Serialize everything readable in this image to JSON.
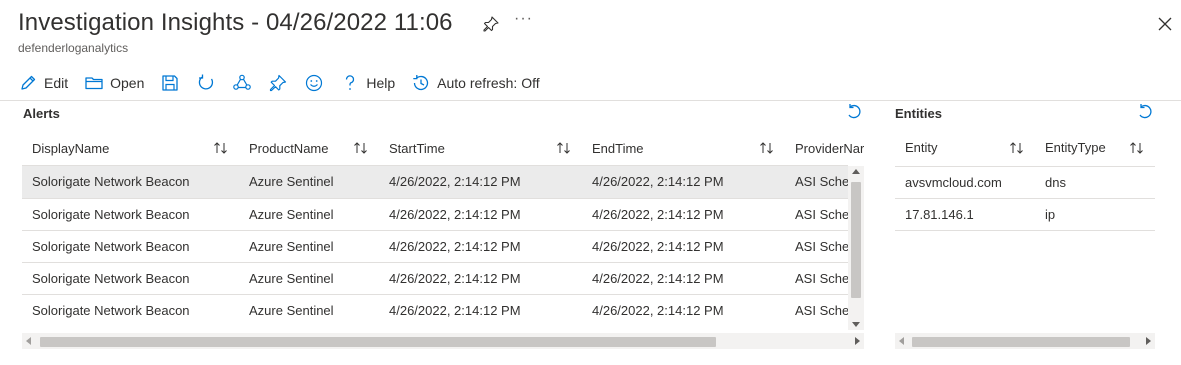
{
  "header": {
    "title": "Investigation Insights - 04/26/2022 11:06",
    "subtitle": "defenderloganalytics"
  },
  "toolbar": {
    "edit_label": "Edit",
    "open_label": "Open",
    "help_label": "Help",
    "auto_refresh_label": "Auto refresh: Off"
  },
  "alerts": {
    "title": "Alerts",
    "columns": [
      "DisplayName",
      "ProductName",
      "StartTime",
      "EndTime",
      "ProviderNar"
    ],
    "rows": [
      [
        "Solorigate Network Beacon",
        "Azure Sentinel",
        "4/26/2022, 2:14:12 PM",
        "4/26/2022, 2:14:12 PM",
        "ASI Sche"
      ],
      [
        "Solorigate Network Beacon",
        "Azure Sentinel",
        "4/26/2022, 2:14:12 PM",
        "4/26/2022, 2:14:12 PM",
        "ASI Sche"
      ],
      [
        "Solorigate Network Beacon",
        "Azure Sentinel",
        "4/26/2022, 2:14:12 PM",
        "4/26/2022, 2:14:12 PM",
        "ASI Sche"
      ],
      [
        "Solorigate Network Beacon",
        "Azure Sentinel",
        "4/26/2022, 2:14:12 PM",
        "4/26/2022, 2:14:12 PM",
        "ASI Sche"
      ],
      [
        "Solorigate Network Beacon",
        "Azure Sentinel",
        "4/26/2022, 2:14:12 PM",
        "4/26/2022, 2:14:12 PM",
        "ASI Sche"
      ]
    ]
  },
  "entities": {
    "title": "Entities",
    "columns": [
      "Entity",
      "EntityType"
    ],
    "rows": [
      [
        "avsvmcloud.com",
        "dns"
      ],
      [
        "17.81.146.1",
        "ip"
      ]
    ]
  },
  "colors": {
    "accent": "#0078d4",
    "icon": "#0078d4",
    "selected_row": "#ebebeb"
  },
  "icons": [
    "pin-icon",
    "more-icon",
    "close-icon",
    "edit-icon",
    "open-icon",
    "save-icon",
    "refresh-icon",
    "share-icon",
    "pin-icon",
    "feedback-icon",
    "help-icon",
    "auto-refresh-icon",
    "undo-icon"
  ]
}
